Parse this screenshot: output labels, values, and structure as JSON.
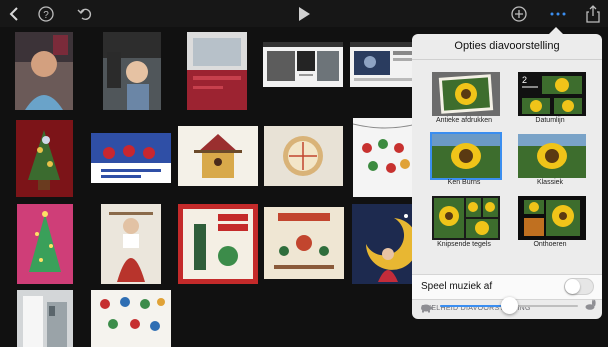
{
  "toolbar": {
    "icons": [
      "back-icon",
      "help-icon",
      "undo-icon",
      "play-icon",
      "add-icon",
      "more-icon",
      "share-icon"
    ]
  },
  "popover": {
    "title": "Opties diavoorstelling",
    "styles": [
      {
        "label": "Antieke afdrukken",
        "selected": false
      },
      {
        "label": "Datumlijn",
        "selected": false
      },
      {
        "label": "Ken Burns",
        "selected": true
      },
      {
        "label": "Klassiek",
        "selected": false
      },
      {
        "label": "Knipsende tegels",
        "selected": false
      },
      {
        "label": "Onthoeren",
        "selected": false
      }
    ],
    "music_label": "Speel muziek af",
    "music_on": false,
    "speed_header": "SNELHEID DIAVOORSTELLING",
    "speed_value": 0.5
  },
  "colors": {
    "accent": "#3b8ef0",
    "background": "#111111",
    "popover": "#ececec"
  }
}
